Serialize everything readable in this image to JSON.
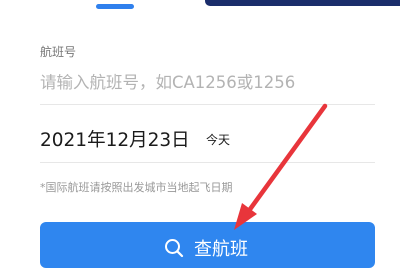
{
  "form": {
    "flight_label": "航班号",
    "flight_placeholder": "请输入航班号，如CA1256或1256",
    "flight_value": "",
    "date_value": "2021年12月23日",
    "date_hint": "今天",
    "intl_note": "*国际航班请按照出发城市当地起飞日期"
  },
  "search_button": {
    "label": "查航班",
    "icon": "search-icon"
  },
  "colors": {
    "accent": "#2f86ef",
    "dark_panel": "#1a2d6b",
    "arrow": "#e8353b"
  }
}
